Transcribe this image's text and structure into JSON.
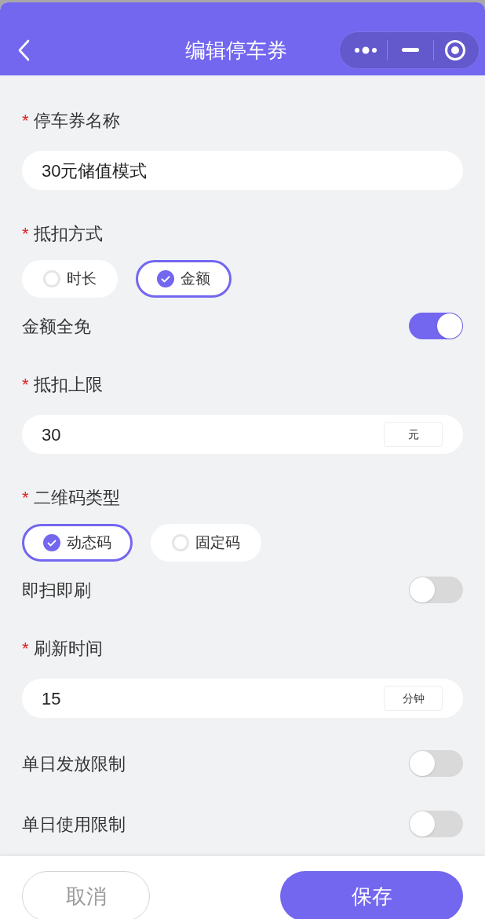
{
  "header": {
    "title": "编辑停车券"
  },
  "form": [
    {
      "kind": "label",
      "mark": "*",
      "text": "停车券名称"
    },
    {
      "kind": "text",
      "value": "30元储值模式"
    },
    {
      "kind": "label",
      "mark": "*",
      "text": "抵扣方式"
    },
    {
      "kind": "radio",
      "options": [
        {
          "label": "时长",
          "selected": false
        },
        {
          "label": "金额",
          "selected": true
        }
      ]
    },
    {
      "kind": "switch",
      "label": "金额全免",
      "on": true
    },
    {
      "kind": "label",
      "mark": "*",
      "text": "抵扣上限"
    },
    {
      "kind": "unit",
      "value": "30",
      "unit": "元"
    },
    {
      "kind": "label",
      "mark": "*",
      "text": "二维码类型"
    },
    {
      "kind": "radio",
      "options": [
        {
          "label": "动态码",
          "selected": true
        },
        {
          "label": "固定码",
          "selected": false
        }
      ]
    },
    {
      "kind": "switch",
      "label": "即扫即刷",
      "on": false
    },
    {
      "kind": "label",
      "mark": "*",
      "text": "刷新时间"
    },
    {
      "kind": "unit",
      "value": "15",
      "unit": "分钟"
    },
    {
      "kind": "switch",
      "label": "单日发放限制",
      "on": false
    },
    {
      "kind": "switch",
      "label": "单日使用限制",
      "on": false
    }
  ],
  "footer": {
    "buttons": [
      {
        "label": "取消",
        "kind": "secondary"
      },
      {
        "label": "保存",
        "kind": "primary"
      }
    ]
  }
}
